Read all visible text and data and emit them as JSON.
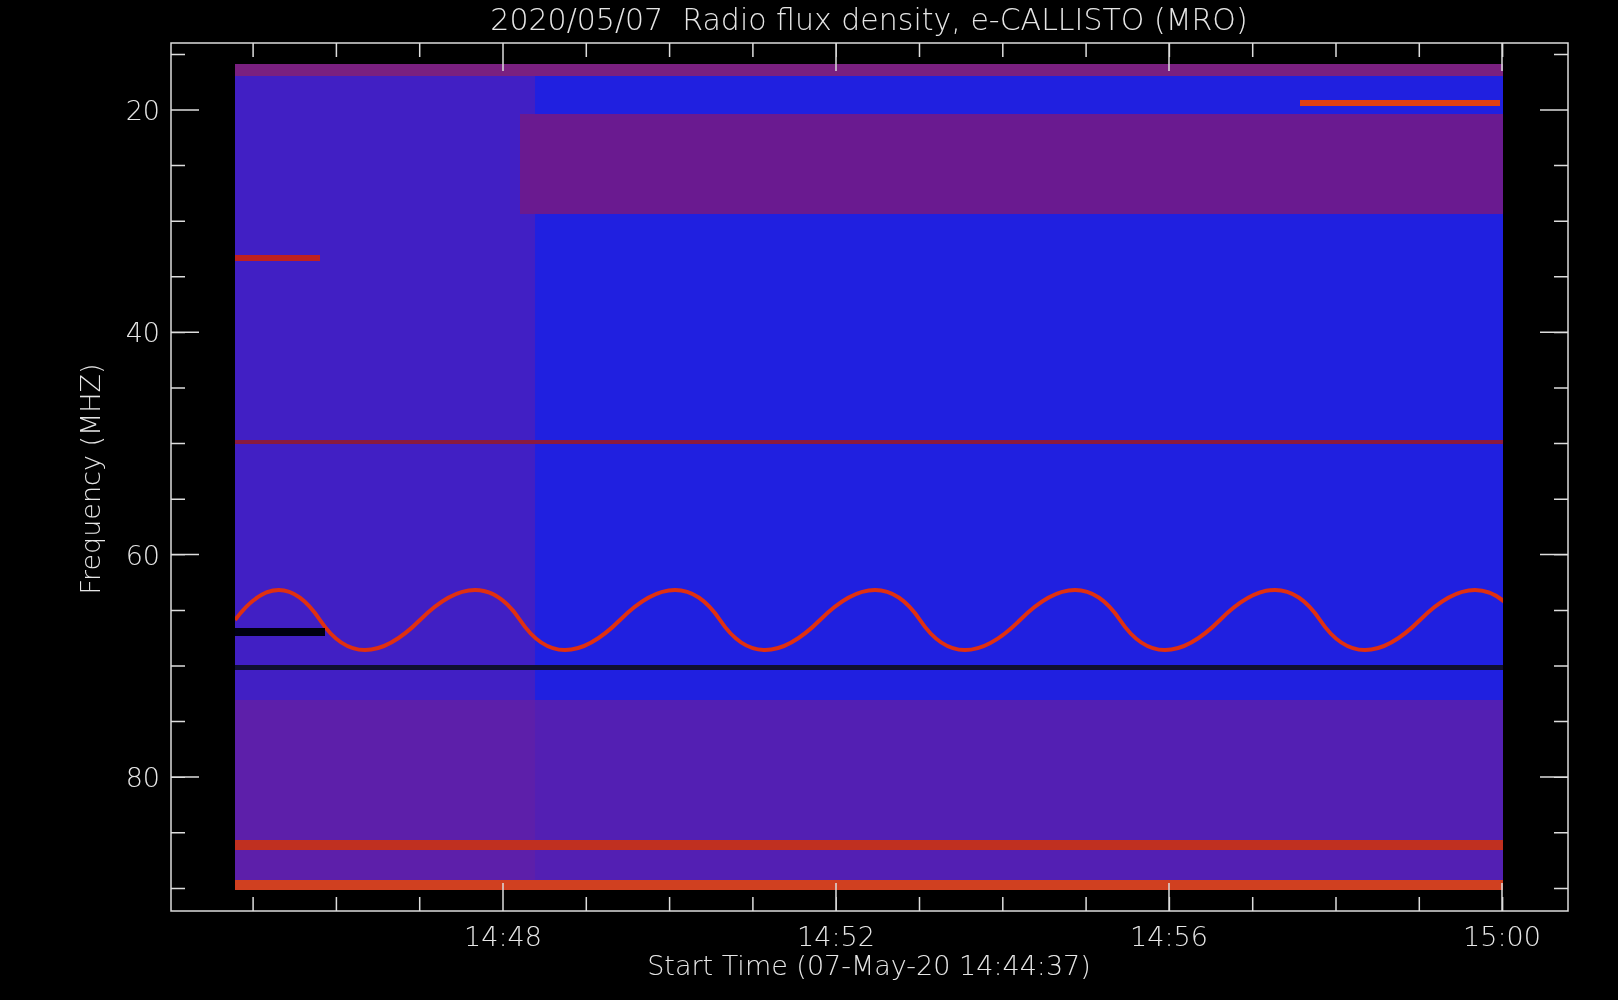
{
  "title": "2020/05/07  Radio flux density, e-CALLISTO (MRO)",
  "y_axis": {
    "label": "Frequency (MHZ)",
    "ticks": [
      "20",
      "40",
      "60",
      "80"
    ]
  },
  "x_axis": {
    "label": "Start Time (07-May-20 14:44:37)",
    "ticks": [
      "14:48",
      "14:52",
      "14:56",
      "15:00"
    ]
  }
}
